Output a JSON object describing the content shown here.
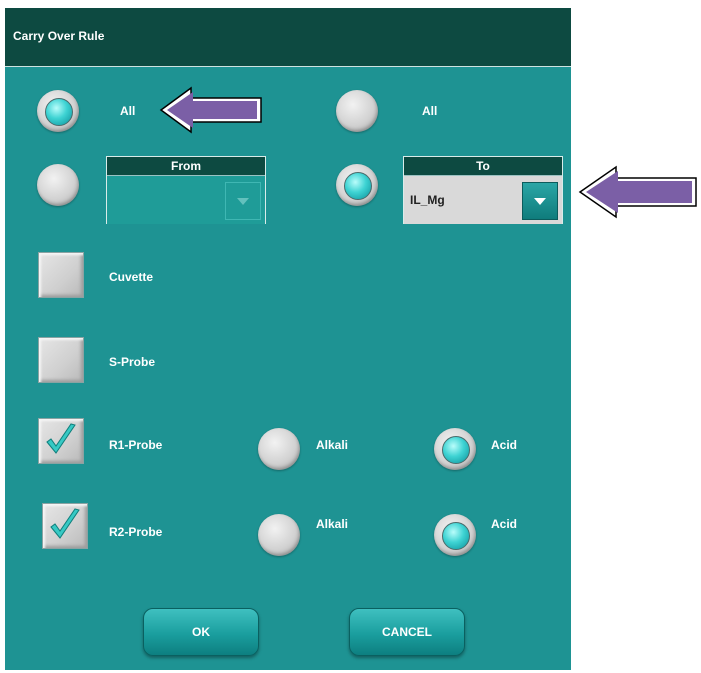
{
  "dialog": {
    "title": "Carry Over Rule"
  },
  "left_group": {
    "all_label": "All",
    "from_label": "From",
    "from_value": ""
  },
  "right_group": {
    "all_label": "All",
    "to_label": "To",
    "to_value": "IL_Mg"
  },
  "options": {
    "cuvette_label": "Cuvette",
    "sprobe_label": "S-Probe",
    "r1_label": "R1-Probe",
    "r2_label": "R2-Probe",
    "alkali_label": "Alkali",
    "acid_label": "Acid"
  },
  "buttons": {
    "ok": "OK",
    "cancel": "CANCEL"
  },
  "state": {
    "left_all_selected": true,
    "left_from_selected": false,
    "right_all_selected": false,
    "right_to_selected": true,
    "cuvette_checked": false,
    "sprobe_checked": false,
    "r1_checked": true,
    "r2_checked": true,
    "r1_mode": "Acid",
    "r2_mode": "Acid"
  },
  "colors": {
    "dialog_bg": "#1e9393",
    "titlebar_bg": "#0d4a41",
    "radio_selected": "#3ed3d3",
    "annotation_arrow": "#7b5fa6"
  }
}
